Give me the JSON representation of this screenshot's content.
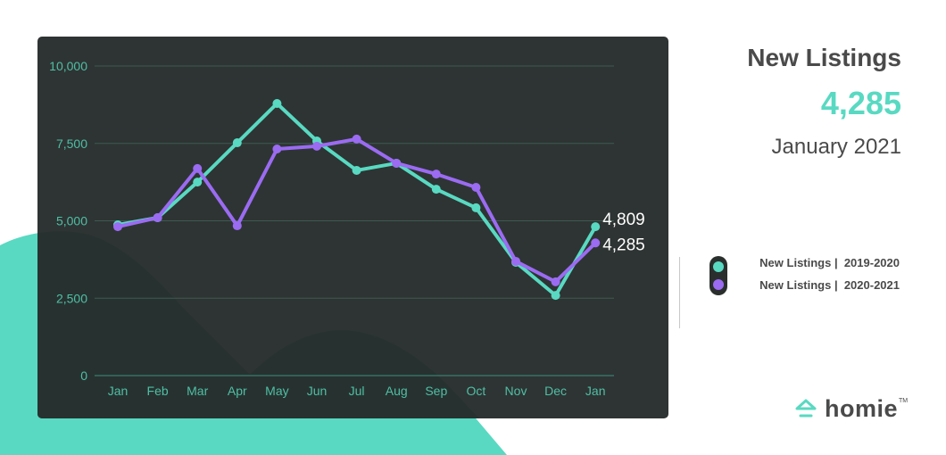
{
  "colors": {
    "teal": "#59d9c2",
    "purple": "#9b6bf2",
    "card_bg": "#2e3433",
    "grid": "#3d5a52",
    "axis_text": "#4fbfa5",
    "text_dark": "#4a4a4a"
  },
  "header": {
    "title": "New Listings",
    "value": "4,285",
    "period": "January 2021"
  },
  "legend": {
    "items": [
      {
        "label": "New Listings |  2019-2020",
        "color": "#59d9c2"
      },
      {
        "label": "New Listings |  2020-2021",
        "color": "#9b6bf2"
      }
    ]
  },
  "brand": {
    "name": "homie",
    "tm": "TM"
  },
  "chart_data": {
    "type": "line",
    "title": "New Listings",
    "xlabel": "",
    "ylabel": "",
    "categories": [
      "Jan",
      "Feb",
      "Mar",
      "Apr",
      "May",
      "Jun",
      "Jul",
      "Aug",
      "Sep",
      "Oct",
      "Nov",
      "Dec",
      "Jan"
    ],
    "ylim": [
      0,
      10000
    ],
    "yticks": [
      0,
      2500,
      5000,
      7500,
      10000
    ],
    "ytick_labels": [
      "0",
      "2,500",
      "5,000",
      "7,500",
      "10,000"
    ],
    "grid": true,
    "legend_position": "right",
    "series": [
      {
        "name": "New Listings | 2019-2020",
        "color": "#59d9c2",
        "values": [
          4870,
          5100,
          6250,
          7520,
          8790,
          7580,
          6630,
          6860,
          6020,
          5420,
          3660,
          2590,
          4809
        ],
        "end_label": "4,809"
      },
      {
        "name": "New Listings | 2020-2021",
        "color": "#9b6bf2",
        "values": [
          4810,
          5100,
          6690,
          4840,
          7320,
          7410,
          7640,
          6860,
          6510,
          6080,
          3690,
          3030,
          4285
        ],
        "end_label": "4,285"
      }
    ]
  }
}
